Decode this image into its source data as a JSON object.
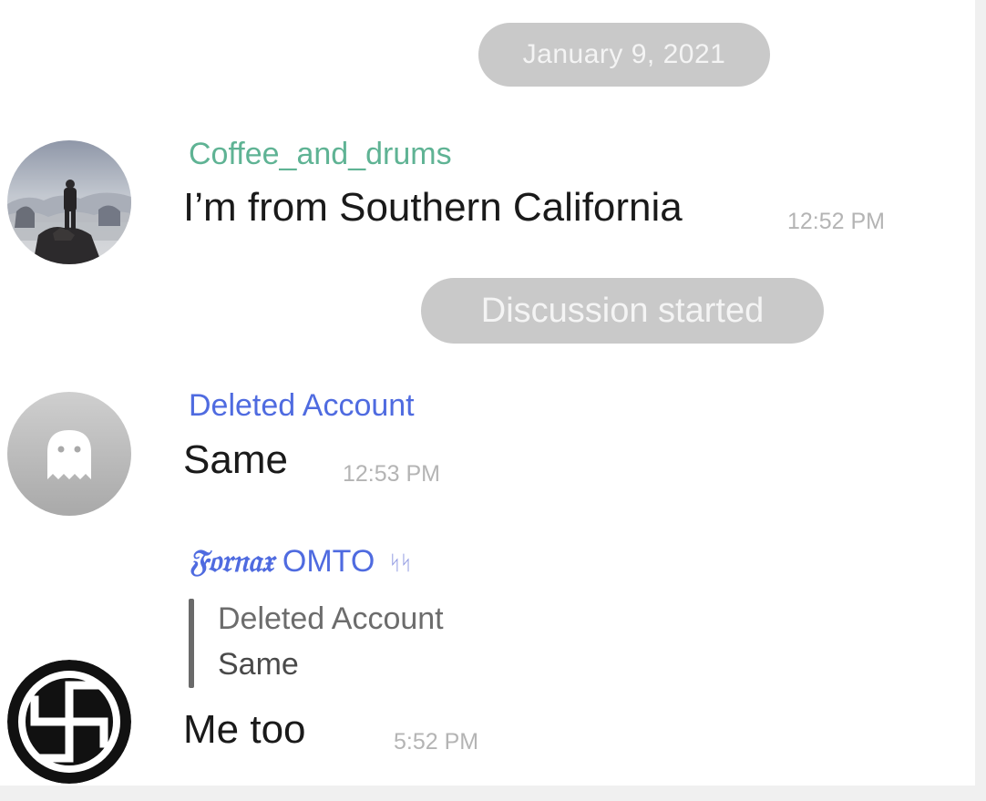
{
  "colors": {
    "chat_background": "#ffffff",
    "outer_background": "#f0f0f0",
    "service_pill": "#c9c9c9",
    "service_text": "#f4f4f4",
    "sender_green": "#5fb394",
    "sender_blue": "#4f6be0",
    "timestamp": "#b4b4b4",
    "message_text": "#1a1a1a"
  },
  "service_messages": {
    "date": "January 9, 2021",
    "discussion": "Discussion started"
  },
  "messages": [
    {
      "sender": "Coffee_and_drums",
      "text": "I’m from Southern California",
      "time": "12:52 PM",
      "avatar_icon": "wanderer-painting-avatar"
    },
    {
      "sender": "Deleted Account",
      "text": "Same",
      "time": "12:53 PM",
      "avatar_icon": "ghost-icon"
    },
    {
      "sender_prefix": "𝔉𝔬𝔯𝔫𝔞𝔵",
      "sender_name": "OMTO",
      "sender_suffix": "ᛋᛋ",
      "reply": {
        "author": "Deleted Account",
        "text": "Same"
      },
      "text": "Me too",
      "time": "5:52 PM",
      "avatar_icon": "circular-symbol-avatar"
    }
  ]
}
